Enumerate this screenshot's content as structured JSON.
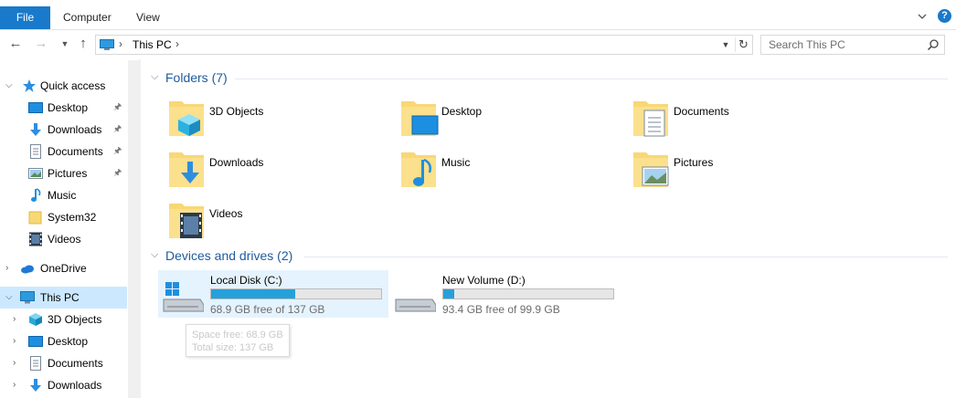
{
  "ribbon": {
    "tabs": [
      "File",
      "Computer",
      "View"
    ],
    "help": "?"
  },
  "address": {
    "path": "This PC",
    "search_placeholder": "Search This PC"
  },
  "nav": {
    "quick_access": "Quick access",
    "quick_items": [
      {
        "label": "Desktop",
        "pinned": true
      },
      {
        "label": "Downloads",
        "pinned": true
      },
      {
        "label": "Documents",
        "pinned": true
      },
      {
        "label": "Pictures",
        "pinned": true
      },
      {
        "label": "Music",
        "pinned": false
      },
      {
        "label": "System32",
        "pinned": false
      },
      {
        "label": "Videos",
        "pinned": false
      }
    ],
    "onedrive": "OneDrive",
    "this_pc": "This PC",
    "pc_items": [
      "3D Objects",
      "Desktop",
      "Documents",
      "Downloads"
    ]
  },
  "content": {
    "folders_header": "Folders (7)",
    "folders": [
      "3D Objects",
      "Desktop",
      "Documents",
      "Downloads",
      "Music",
      "Pictures",
      "Videos"
    ],
    "drives_header": "Devices and drives (2)",
    "drives": [
      {
        "name": "Local Disk (C:)",
        "free_text": "68.9 GB free of 137 GB",
        "used_fraction": 0.497
      },
      {
        "name": "New Volume (D:)",
        "free_text": "93.4 GB free of 99.9 GB",
        "used_fraction": 0.065
      }
    ]
  },
  "tooltip": {
    "line1": "Space free: 68.9 GB",
    "line2": "Total size: 137 GB"
  },
  "colors": {
    "accent": "#1979ca",
    "selection": "#cce8ff",
    "drive_bar": "#26a0da",
    "folder": "#f8d775"
  }
}
